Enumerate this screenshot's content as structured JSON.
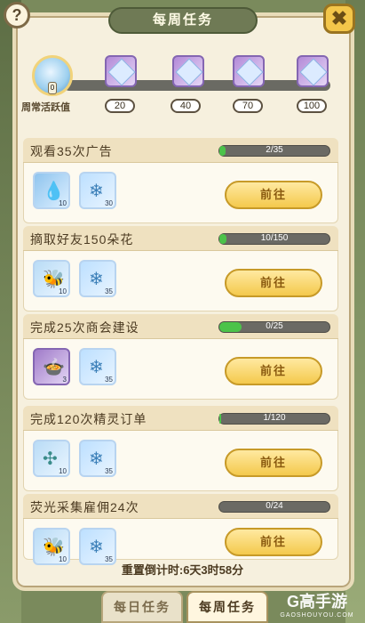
{
  "header": {
    "title": "每周任务",
    "help_icon": "?",
    "close_icon": "✖"
  },
  "weekly_progress": {
    "label": "周常活跃值",
    "current_count": "0",
    "milestones": [
      {
        "value": "20"
      },
      {
        "value": "40"
      },
      {
        "value": "70"
      },
      {
        "value": "100"
      }
    ]
  },
  "tasks": [
    {
      "title": "观看35次广告",
      "progress_text": "2/35",
      "progress_fraction": 0.057,
      "button": "前往",
      "rewards": [
        {
          "icon": "water-drop-icon",
          "count": "10"
        },
        {
          "icon": "leaf-crystal-icon",
          "count": "30"
        }
      ]
    },
    {
      "title": "摘取好友150朵花",
      "progress_text": "10/150",
      "progress_fraction": 0.067,
      "button": "前往",
      "rewards": [
        {
          "icon": "honey-bee-icon",
          "count": "10"
        },
        {
          "icon": "leaf-crystal-icon",
          "count": "35"
        }
      ]
    },
    {
      "title": "完成25次商会建设",
      "progress_text": "0/25",
      "progress_fraction": 0.2,
      "button": "前往",
      "rewards": [
        {
          "icon": "cooking-pot-icon",
          "count": "3"
        },
        {
          "icon": "leaf-crystal-icon",
          "count": "35"
        }
      ]
    },
    {
      "title": "完成120次精灵订单",
      "progress_text": "1/120",
      "progress_fraction": 0.008,
      "button": "前往",
      "rewards": [
        {
          "icon": "pinwheel-icon",
          "count": "10"
        },
        {
          "icon": "leaf-crystal-icon",
          "count": "35"
        }
      ]
    },
    {
      "title": "荧光采集雇佣24次",
      "progress_text": "0/24",
      "progress_fraction": 0.0,
      "button": "前往",
      "rewards": [
        {
          "icon": "honey-bee-icon",
          "count": "10"
        },
        {
          "icon": "leaf-crystal-icon",
          "count": "35"
        }
      ]
    }
  ],
  "reset_countdown": "重置倒计时:6天3时58分",
  "bottom_tabs": {
    "daily": "每日任务",
    "weekly": "每周任务"
  },
  "watermark": {
    "brand": "G高手游",
    "domain": "GAOSHOUYOU.COM"
  },
  "colors": {
    "progress_fill": "#4cc34a",
    "button_gold": "#f4c94c",
    "title_bar_green": "#6f7a55"
  }
}
